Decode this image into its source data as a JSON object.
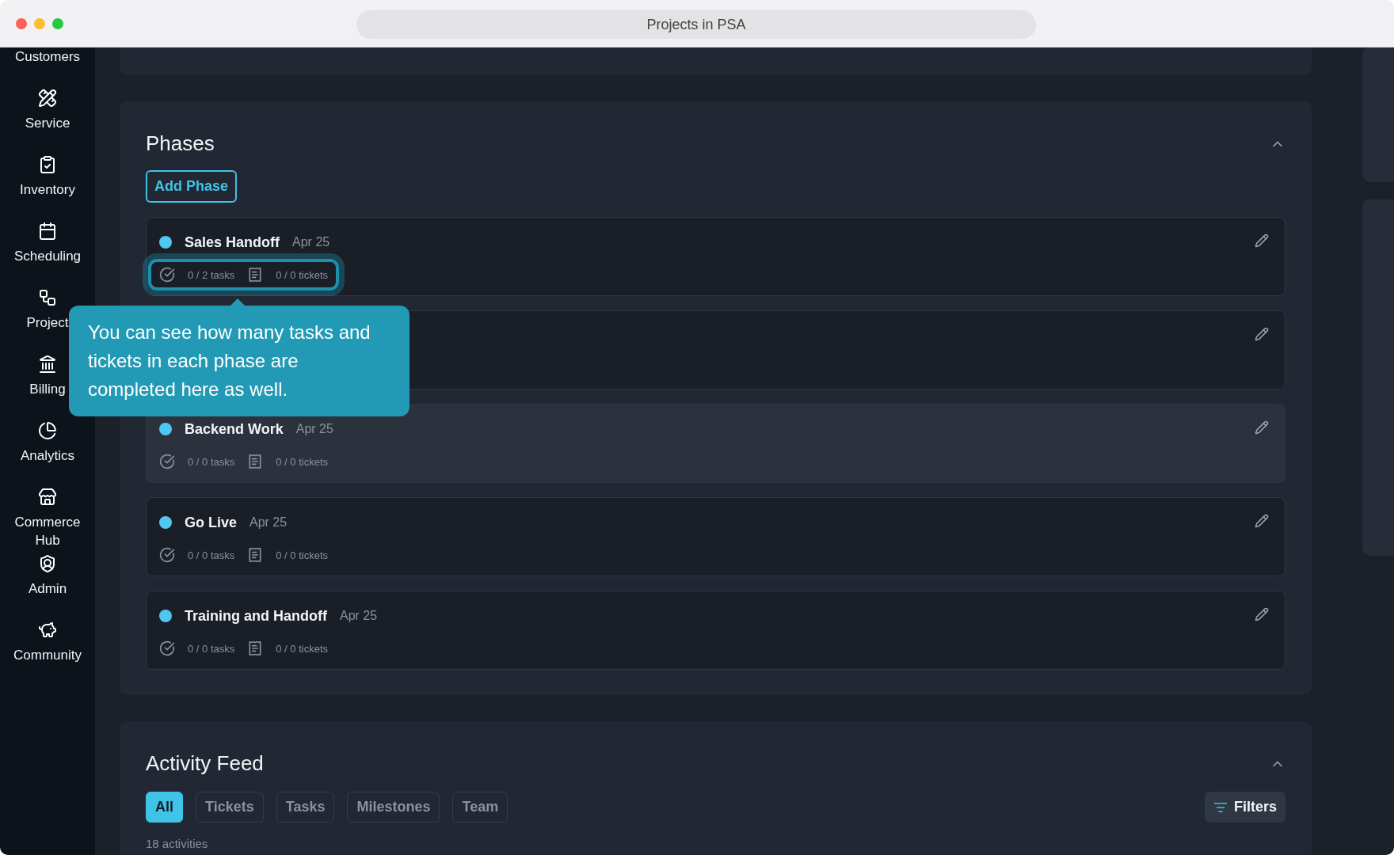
{
  "window": {
    "title": "Projects in PSA"
  },
  "sidebar": {
    "items": [
      {
        "label": "Customers"
      },
      {
        "label": "Service"
      },
      {
        "label": "Inventory"
      },
      {
        "label": "Scheduling"
      },
      {
        "label": "Project"
      },
      {
        "label": "Billing"
      },
      {
        "label": "Analytics"
      },
      {
        "label": "Commerce Hub"
      },
      {
        "label": "Admin"
      },
      {
        "label": "Community"
      }
    ]
  },
  "phases": {
    "title": "Phases",
    "expanded": true,
    "add_button": "Add Phase",
    "items": [
      {
        "name": "Sales Handoff",
        "date": "Apr 25",
        "tasks": "0 / 2 tasks",
        "tickets": "0 / 0 tickets",
        "highlighted": true,
        "hovered": false
      },
      {
        "hovered": false,
        "highlighted": false
      },
      {
        "name": "Backend Work",
        "date": "Apr 25",
        "tasks": "0 / 0 tasks",
        "tickets": "0 / 0 tickets",
        "highlighted": false,
        "hovered": true
      },
      {
        "name": "Go Live",
        "date": "Apr 25",
        "tasks": "0 / 0 tasks",
        "tickets": "0 / 0 tickets",
        "highlighted": false,
        "hovered": false
      },
      {
        "name": "Training and Handoff",
        "date": "Apr 25",
        "tasks": "0 / 0 tasks",
        "tickets": "0 / 0 tickets",
        "highlighted": false,
        "hovered": false
      }
    ]
  },
  "tooltip": {
    "text": "You can see how many tasks and tickets in each phase are completed here as well."
  },
  "activity_feed": {
    "title": "Activity Feed",
    "expanded": true,
    "filters": [
      {
        "label": "All",
        "selected": true
      },
      {
        "label": "Tickets",
        "selected": false
      },
      {
        "label": "Tasks",
        "selected": false
      },
      {
        "label": "Milestones",
        "selected": false
      },
      {
        "label": "Team",
        "selected": false
      }
    ],
    "filters_button": "Filters",
    "count": "18 activities"
  }
}
